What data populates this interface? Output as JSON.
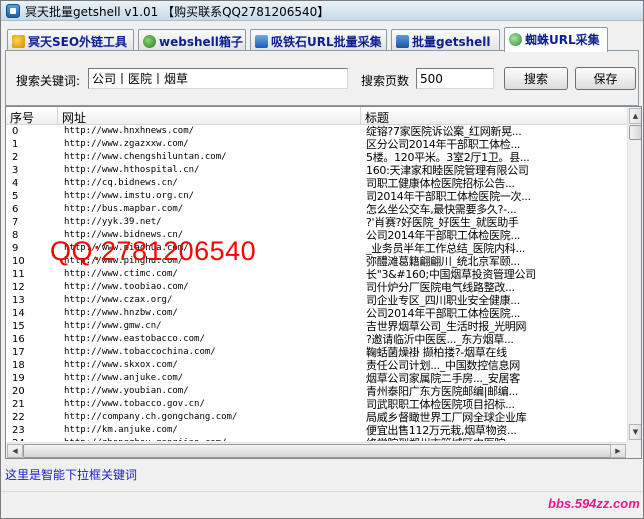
{
  "window": {
    "title": "冥天批量getshell v1.01      【购买联系QQ2781206540】"
  },
  "tabs": [
    {
      "label": "冥天SEO外链工具",
      "icon": "gold-coin-icon"
    },
    {
      "label": "webshell箱子",
      "icon": "globe-icon"
    },
    {
      "label": "吸铁石URL批量采集",
      "icon": "magnet-icon"
    },
    {
      "label": "批量getshell",
      "icon": "shield-icon"
    },
    {
      "label": "蜘蛛URL采集",
      "icon": "spider-icon",
      "active": true
    }
  ],
  "search": {
    "keyword_label": "搜索关键词:",
    "keyword_value": "公司丨医院丨烟草",
    "pages_label": "搜索页数",
    "pages_value": "500",
    "search_button": "搜索",
    "save_button": "保存"
  },
  "table": {
    "columns": [
      "序号",
      "网址",
      "标题"
    ],
    "rows": [
      [
        "0",
        "http://www.hnxhnews.com/",
        "绽镕?7家医院诉讼案_红网新晃..."
      ],
      [
        "1",
        "http://www.zgazxxw.com/",
        "区分公司2014年干部职工体检..."
      ],
      [
        "2",
        "http://www.chengshiluntan.com/",
        "5楼。120平米。3室2厅1卫。县..."
      ],
      [
        "3",
        "http://www.hthospital.cn/",
        "160:天津家和睦医院管理有限公司"
      ],
      [
        "4",
        "http://cq.bidnews.cn/",
        "司职工健康体检医院招标公告..."
      ],
      [
        "5",
        "http://www.imstu.org.cn/",
        "司2014年干部职工体检医院一次..."
      ],
      [
        "6",
        "http://bus.mapbar.com/",
        "怎么坐公交车,最快需要多久?-..."
      ],
      [
        "7",
        "http://yyk.39.net/",
        "?'肖赛?好医院_好医生_就医助手"
      ],
      [
        "8",
        "http://www.bidnews.cn/",
        "公司2014年干部职工体检医院..."
      ],
      [
        "9",
        "http://www.piaohua.com/",
        "_业务员半年工作总结_医院内科..."
      ],
      [
        "10",
        "http://www.pinghu.com/",
        "弥醴滩葛籍翩翩川_统北京军颐..."
      ],
      [
        "11",
        "http://www.ctimc.com/",
        "长\"3&#160;中国烟草投资管理公司"
      ],
      [
        "12",
        "http://www.toobiao.com/",
        "司什炉分厂医院电气线路整改..."
      ],
      [
        "13",
        "http://www.czax.org/",
        "司企业专区_四川职业安全健康..."
      ],
      [
        "14",
        "http://www.hnzbw.com/",
        "公司2014年干部职工体检医院..."
      ],
      [
        "15",
        "http://www.gmw.cn/",
        "吉世界烟草公司_生活时报_光明网"
      ],
      [
        "16",
        "http://www.eastobacco.com/",
        "?邀请临沂中医医..._东方烟草..."
      ],
      [
        "17",
        "http://www.tobaccochina.com/",
        "鞠蛞菌燥褂   撷柏搂?-烟草在线"
      ],
      [
        "18",
        "http://www.skxox.com/",
        "责任公司计划..._中国数控信息网"
      ],
      [
        "19",
        "http://www.anjuke.com/",
        "烟草公司家属院二手房..._安居客"
      ],
      [
        "20",
        "http://www.youbian.com/",
        "青州泰阳广东方医院邮编|邮编..."
      ],
      [
        "21",
        "http://www.tobacco.gov.cn/",
        "司武职职工体检医院项目招标..."
      ],
      [
        "22",
        "http://company.ch.gongchang.com/",
        "局威乡督瞰世界工厂网全球企业库"
      ],
      [
        "23",
        "http://km.anjuke.com/",
        "便宜出售112万元栽,烟草物资..."
      ],
      [
        "24",
        "http://zhengzhou.gongjiao.com/",
        "终学院到郑州市管城区中医院..."
      ]
    ]
  },
  "status": {
    "text": "这里是智能下拉框关键词"
  },
  "overlays": {
    "watermark": "QQ:2781206540",
    "site": "bbs.594zz.com"
  }
}
